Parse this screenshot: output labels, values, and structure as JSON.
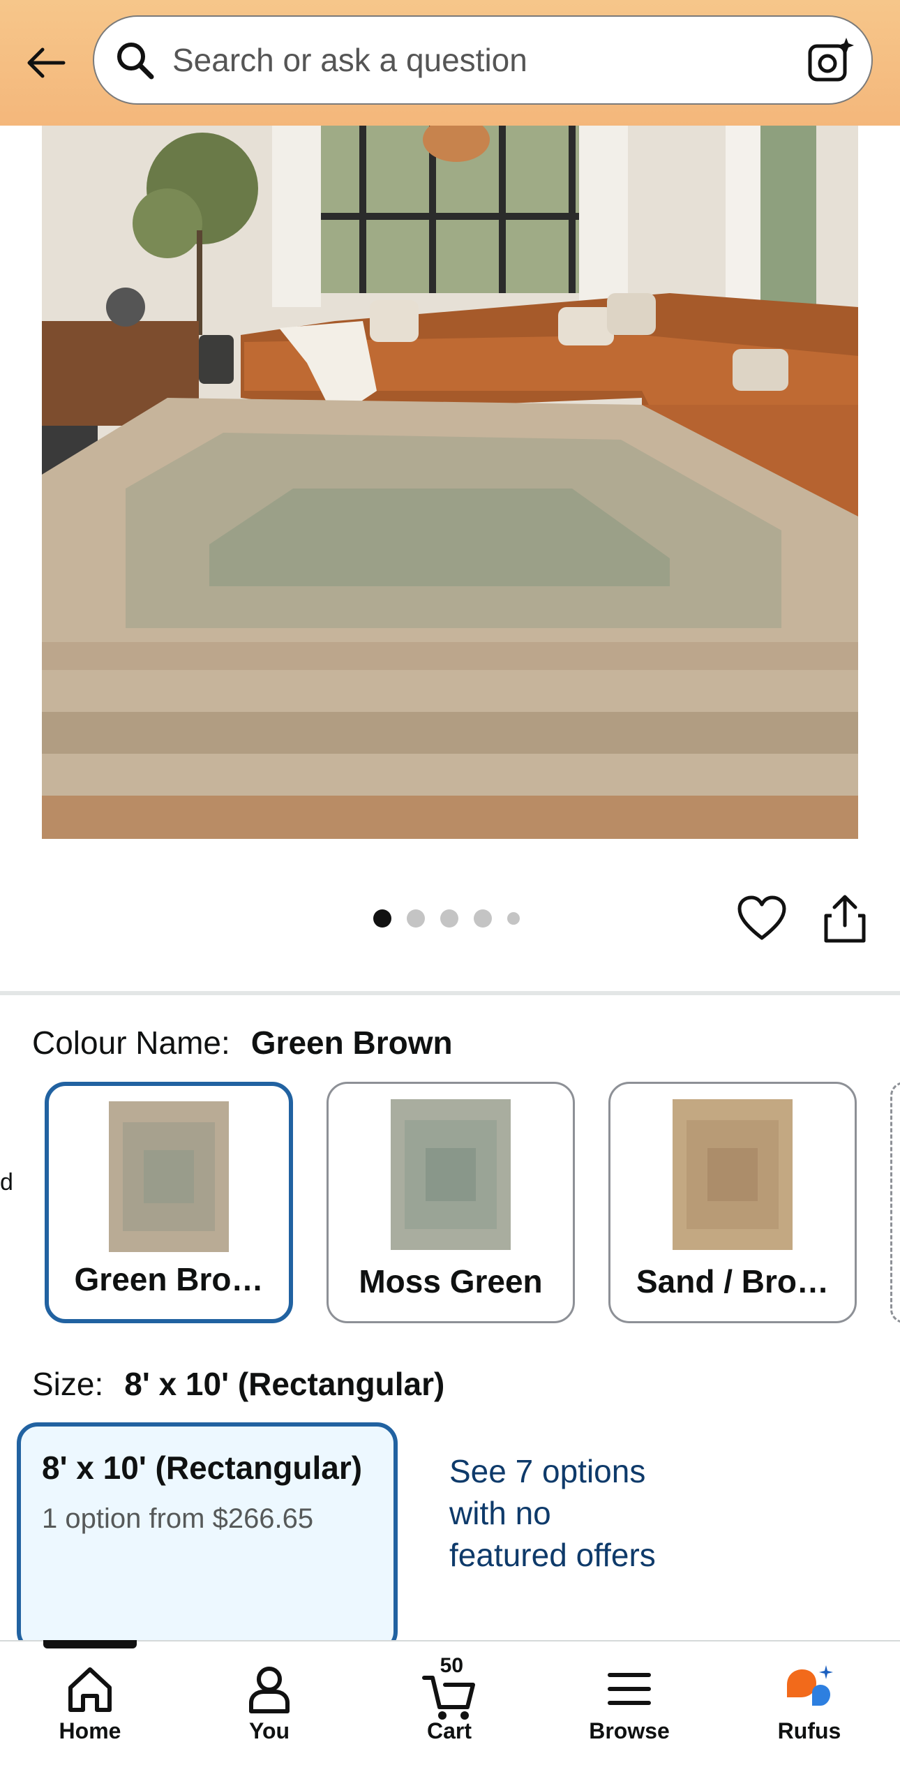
{
  "search": {
    "placeholder": "Search or ask a question"
  },
  "gallery": {
    "dots": 5,
    "active_index": 0
  },
  "colour": {
    "label": "Colour Name:",
    "value": "Green Brown",
    "options": [
      {
        "name": "Green Bro…",
        "selected": true,
        "tint": "#b9ab95"
      },
      {
        "name": "Moss Green",
        "selected": false,
        "tint": "#a9ad9f"
      },
      {
        "name": "Sand / Bro…",
        "selected": false,
        "tint": "#c3a882"
      }
    ]
  },
  "size": {
    "label": "Size:",
    "value": "8' x 10' (Rectangular)",
    "selected_option": {
      "title": "8' x 10' (Rectangular)",
      "subtitle": "1 option from $266.65"
    },
    "see_more": "See 7 options with no featured offers"
  },
  "tabs": [
    {
      "label": "Home",
      "icon": "home-icon"
    },
    {
      "label": "You",
      "icon": "user-icon"
    },
    {
      "label": "Cart",
      "icon": "cart-icon",
      "badge": "50"
    },
    {
      "label": "Browse",
      "icon": "menu-icon"
    },
    {
      "label": "Rufus",
      "icon": "rufus-icon"
    }
  ],
  "colors": {
    "accent": "#2162a1",
    "header": "#f4b77b",
    "link": "#0e3a6a"
  }
}
